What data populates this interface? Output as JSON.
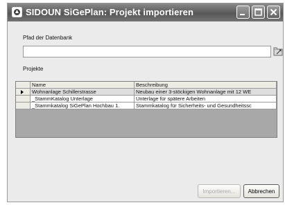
{
  "window": {
    "title": "SIDOUN SiGePlan: Projekt importieren",
    "controls": [
      "minimize-icon",
      "maximize-icon",
      "close-icon"
    ]
  },
  "database_path": {
    "label": "Pfad der Datenbank",
    "value": "",
    "browse_icon": "browse-folder-icon"
  },
  "projects": {
    "label": "Projekte",
    "columns": [
      "Name",
      "Beschreibung"
    ],
    "rows": [
      {
        "name": "Wohnanlage Schillerstrasse",
        "description": "Neubau einer 3-stöckigen Wohnanlage mit 12 WE",
        "selected": true
      },
      {
        "name": "_StammKatalog Unterlage",
        "description": "Unterlage für spätere Arbeiten",
        "selected": false
      },
      {
        "name": "_Stammkatalog SiGePlan Hochbau 1.",
        "description": "Stammkatalog für Sicherheits- und Gesundheitssc",
        "selected": false
      }
    ]
  },
  "buttons": {
    "import": "Importieren...",
    "cancel": "Abbrechen"
  }
}
